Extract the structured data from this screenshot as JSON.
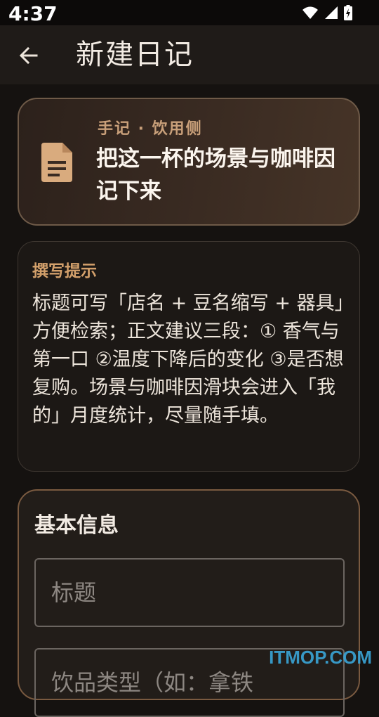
{
  "status": {
    "time": "4:37",
    "icons": [
      "wifi-icon",
      "signal-icon",
      "battery-charging-icon"
    ]
  },
  "app_bar": {
    "back_icon": "arrow-left-icon",
    "title": "新建日记"
  },
  "hero": {
    "icon": "document-icon",
    "eyebrow": "手记 · 饮用侧",
    "title": "把这一杯的场景与咖啡因记下来"
  },
  "tips": {
    "title": "撰写提示",
    "body": "标题可写「店名 + 豆名缩写 + 器具」方便检索；正文建议三段：① 香气与第一口 ②温度下降后的变化 ③是否想复购。场景与咖啡因滑块会进入「我的」月度统计，尽量随手填。"
  },
  "form": {
    "section_title": "基本信息",
    "title_placeholder": "标题",
    "type_placeholder": "饮品类型（如：拿铁"
  },
  "watermark": "ITMOP.COM",
  "colors": {
    "background": "#151210",
    "accent": "#c9a07a",
    "tip_title": "#d3a06b",
    "watermark": "#3aa6d8"
  }
}
